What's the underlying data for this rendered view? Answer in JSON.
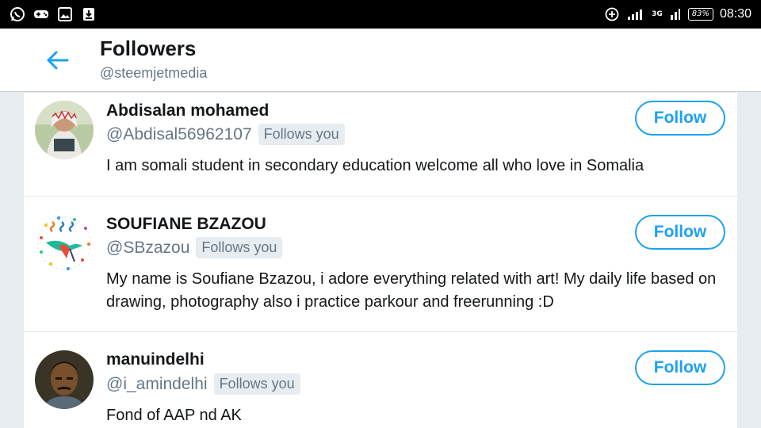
{
  "status_bar": {
    "time": "08:30",
    "battery": "83%",
    "network": "3G"
  },
  "header": {
    "title": "Followers",
    "subtitle": "@steemjetmedia"
  },
  "followers": [
    {
      "name": "Abdisalan mohamed",
      "handle": "@Abdisal56962107",
      "badge": "Follows you",
      "bio": "I am somali student in secondary education welcome all who love in Somalia",
      "button": "Follow"
    },
    {
      "name": "SOUFIANE BZAZOU",
      "handle": "@SBzazou",
      "badge": "Follows you",
      "bio": "My name is Soufiane Bzazou, i adore everything related with art! My daily life based on drawing, photography also i practice parkour and freerunning :D",
      "button": "Follow"
    },
    {
      "name": "manuindelhi",
      "handle": "@i_amindelhi",
      "badge": "Follows you",
      "bio": "Fond of AAP nd AK",
      "button": "Follow"
    }
  ],
  "colors": {
    "accent": "#1da1f2",
    "secondary_text": "#657786",
    "background": "#e6ecf0"
  }
}
